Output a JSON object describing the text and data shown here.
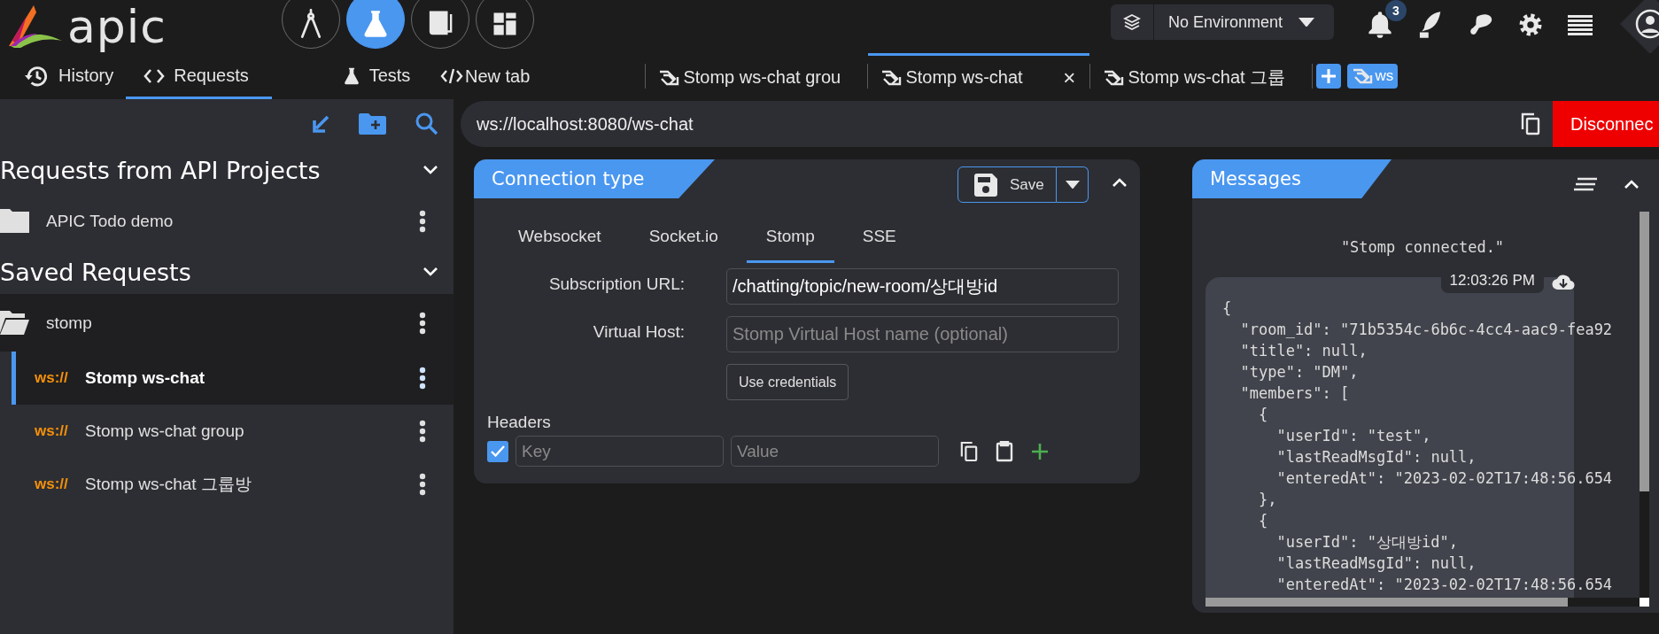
{
  "header": {
    "logo": "apic",
    "nav": [
      {
        "kind": "designer",
        "selected": false
      },
      {
        "kind": "tester",
        "selected": true
      },
      {
        "kind": "docs",
        "selected": false
      },
      {
        "kind": "dashboard",
        "selected": false
      }
    ],
    "environment": "No Environment",
    "notification_count": "3"
  },
  "view_tabs": [
    {
      "kind": "history",
      "label": "History",
      "selected": false
    },
    {
      "kind": "requests",
      "label": "Requests",
      "selected": true
    },
    {
      "kind": "tests",
      "label": "Tests",
      "selected": false
    }
  ],
  "new_tab": "New tab",
  "request_tabs": [
    {
      "label": "Stomp ws-chat grou",
      "selected": false
    },
    {
      "label": "Stomp ws-chat",
      "selected": true,
      "close": "×"
    },
    {
      "label": "Stomp ws-chat 그룹",
      "selected": false
    }
  ],
  "new_ws_tab": "ws",
  "sidebar": {
    "sections": [
      {
        "title": "Requests from API Projects",
        "expanded": true,
        "items": [
          {
            "label": "APIC Todo demo",
            "expanded": false
          }
        ]
      },
      {
        "title": "Saved Requests",
        "expanded": true,
        "items": [
          {
            "label": "stomp",
            "expanded": true,
            "children": [
              {
                "method": "ws://",
                "label": "Stomp ws-chat",
                "selected": true
              },
              {
                "method": "ws://",
                "label": "Stomp ws-chat group",
                "selected": false
              },
              {
                "method": "ws://",
                "label": "Stomp ws-chat 그룹방",
                "selected": false
              }
            ]
          }
        ]
      }
    ]
  },
  "url_bar": {
    "value": "ws://localhost:8080/ws-chat",
    "disconnect": "Disconnec"
  },
  "connection": {
    "title": "Connection type",
    "save": "Save",
    "tabs": [
      {
        "label": "Websocket",
        "selected": false
      },
      {
        "label": "Socket.io",
        "selected": false
      },
      {
        "label": "Stomp",
        "selected": true
      },
      {
        "label": "SSE",
        "selected": false
      }
    ],
    "fields": [
      {
        "label": "Subscription URL:",
        "value": "/chatting/topic/new-room/상대방id"
      },
      {
        "label": "Virtual Host:",
        "placeholder": "Stomp Virtual Host name (optional)"
      }
    ],
    "credentials": "Use credentials",
    "headers": {
      "title": "Headers",
      "rows": [
        {
          "checked": true,
          "key_placeholder": "Key",
          "value_placeholder": "Value"
        }
      ]
    }
  },
  "messages": {
    "title": "Messages",
    "items": [
      {
        "kind": "info",
        "text": "\"Stomp connected.\""
      },
      {
        "kind": "received",
        "time": "12:03:26 PM",
        "lines": [
          "{",
          "  \"room_id\": \"71b5354c-6b6c-4cc4-aac9-fea92",
          "  \"title\": null,",
          "  \"type\": \"DM\",",
          "  \"members\": [",
          "    {",
          "      \"userId\": \"test\",",
          "      \"lastReadMsgId\": null,",
          "      \"enteredAt\": \"2023-02-02T17:48:56.654",
          "    },",
          "    {",
          "      \"userId\": \"상대방id\",",
          "      \"lastReadMsgId\": null,",
          "      \"enteredAt\": \"2023-02-02T17:48:56.654"
        ]
      }
    ]
  }
}
